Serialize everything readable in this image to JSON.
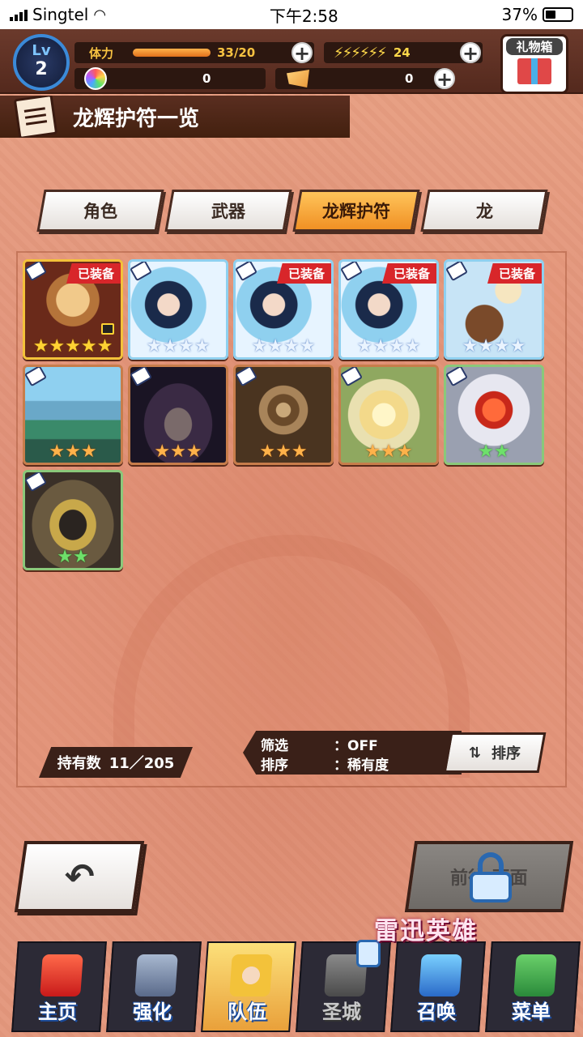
{
  "status_bar": {
    "carrier": "Singtel",
    "time": "下午2:58",
    "battery": "37%"
  },
  "header": {
    "level_label": "Lv",
    "level": "2",
    "stamina_label": "体力",
    "stamina_value": "33/20",
    "stamina_fill": 1.0,
    "bolt_count": "24",
    "gem_count": "0",
    "ticket_count": "0",
    "gift_label": "礼物箱"
  },
  "title": "龙辉护符一览",
  "tabs": [
    {
      "label": "角色",
      "active": false
    },
    {
      "label": "武器",
      "active": false
    },
    {
      "label": "龙辉护符",
      "active": true
    },
    {
      "label": "龙",
      "active": false
    }
  ],
  "equipped_label": "已装备",
  "cards": [
    {
      "stars": 5,
      "equipped": true,
      "frame": "gold",
      "art": "portrait-blonde",
      "locked": true
    },
    {
      "stars": 4,
      "equipped": false,
      "frame": "blue",
      "art": "girl-blue",
      "locked": false
    },
    {
      "stars": 4,
      "equipped": true,
      "frame": "blue",
      "art": "girl-blue",
      "locked": false
    },
    {
      "stars": 4,
      "equipped": true,
      "frame": "blue",
      "art": "girl-blue",
      "locked": false
    },
    {
      "stars": 4,
      "equipped": true,
      "frame": "blue",
      "art": "heroes",
      "locked": false
    },
    {
      "stars": 3,
      "equipped": false,
      "frame": "bronze",
      "art": "castle",
      "locked": false
    },
    {
      "stars": 3,
      "equipped": false,
      "frame": "bronze",
      "art": "dark-bird",
      "locked": false
    },
    {
      "stars": 3,
      "equipped": false,
      "frame": "bronze",
      "art": "gears",
      "locked": false
    },
    {
      "stars": 3,
      "equipped": false,
      "frame": "bronze",
      "art": "lilies",
      "locked": false
    },
    {
      "stars": 2,
      "equipped": false,
      "frame": "green",
      "art": "red-gem",
      "locked": false
    },
    {
      "stars": 2,
      "equipped": false,
      "frame": "green",
      "art": "ring",
      "locked": false
    }
  ],
  "footer": {
    "count_label": "持有数",
    "count_value": "11／205",
    "filter_label": "筛选",
    "filter_value": "：OFF",
    "sort_label": "排序",
    "sort_value": "：稀有度",
    "sort_button": "排序"
  },
  "next_button": "前往    页面",
  "event_text": "雷迅英雄",
  "nav": [
    {
      "label": "主页",
      "icon": "home-icon",
      "active": false,
      "disabled": false
    },
    {
      "label": "强化",
      "icon": "hammer-icon",
      "active": false,
      "disabled": false
    },
    {
      "label": "队伍",
      "icon": "party-icon",
      "active": true,
      "disabled": false
    },
    {
      "label": "圣城",
      "icon": "castle-icon",
      "active": false,
      "disabled": true
    },
    {
      "label": "召唤",
      "icon": "crystal-icon",
      "active": false,
      "disabled": false
    },
    {
      "label": "菜单",
      "icon": "book-icon",
      "active": false,
      "disabled": false
    }
  ],
  "colors": {
    "background": "#e39a7c",
    "header": "#54291d",
    "tab_active": "#f09024",
    "equipped_badge": "#d8262a"
  }
}
